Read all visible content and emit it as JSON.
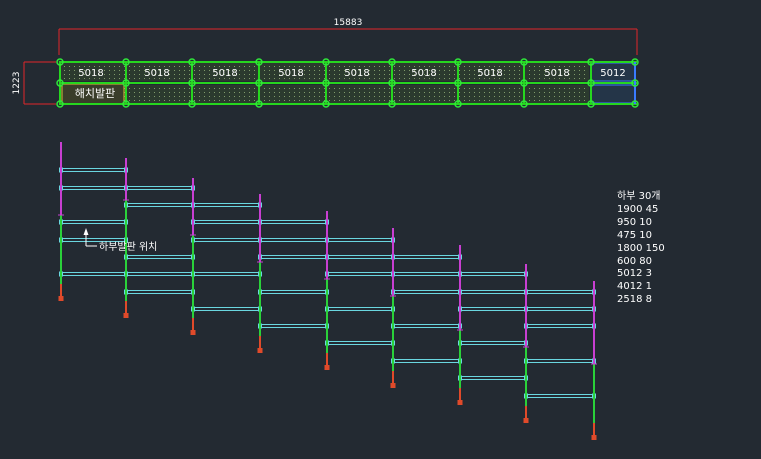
{
  "plan": {
    "total_length": "15883",
    "height_dim": "1223",
    "bay_labels": [
      "5018",
      "5018",
      "5018",
      "5018",
      "5018",
      "5018",
      "5018",
      "5018",
      "5012"
    ],
    "hatch_label": "해치발판"
  },
  "elevation": {
    "annotation": "하부발판 위치"
  },
  "parts_list": {
    "title": "하부 30개",
    "items": [
      "1900 45",
      "950 10",
      "475 10",
      "1800 150",
      "600 80",
      "5012 3",
      "4012 1",
      "2518 8"
    ]
  },
  "colors": {
    "background": "#232a32",
    "dimension": "#e0262a",
    "plan_frame": "#26d61f",
    "node": "#2fe83a",
    "ledger": "#6ad7e0",
    "post_top": "#c83fd2",
    "post_mid": "#2ad13a",
    "post_base": "#e04a2a",
    "last_bay": "#3a7bff"
  }
}
